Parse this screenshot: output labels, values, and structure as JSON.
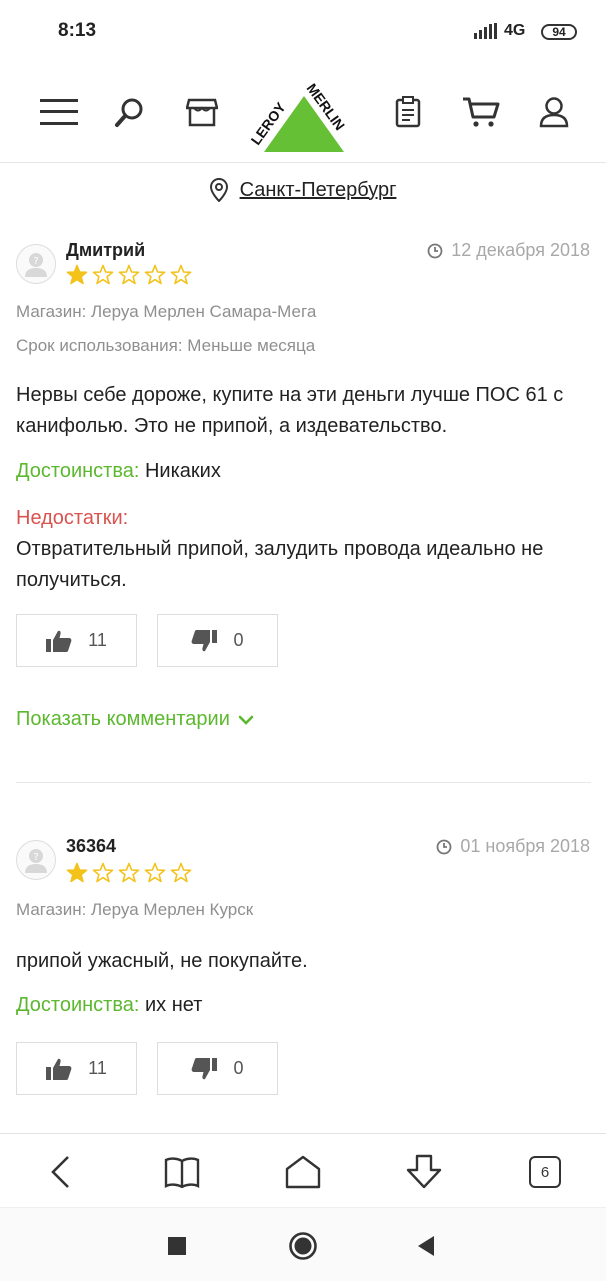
{
  "status": {
    "time": "8:13",
    "network": "4G",
    "battery": "94"
  },
  "city": {
    "name": "Санкт-Петербург"
  },
  "reviews": [
    {
      "author": "Дмитрий",
      "date": "12 декабря 2018",
      "rating": 1,
      "store": "Магазин: Леруа Мерлен Самара-Мега",
      "usage": "Срок использования: Меньше месяца",
      "text": "Нервы себе дороже, купите на эти деньги лучше ПОС 61 с канифолью. Это не припой, а издевательство.",
      "pros_label": "Достоинства:",
      "pros": "Никаких",
      "cons_label": "Недостатки:",
      "cons": "Отвратительный припой, залудить провода идеально не получиться.",
      "likes": "11",
      "dislikes": "0",
      "show_comments": "Показать комментарии"
    },
    {
      "author": "36364",
      "date": "01 ноября 2018",
      "rating": 1,
      "store": "Магазин: Леруа Мерлен Курск",
      "text": "припой ужасный, не покупайте.",
      "pros_label": "Достоинства:",
      "pros": "их нет",
      "likes": "11",
      "dislikes": "0"
    }
  ],
  "browser": {
    "tabs_count": "6"
  },
  "logo": {
    "text_left": "LEROY",
    "text_right": "MERLIN"
  },
  "colors": {
    "accent_green": "#5cb82e",
    "cons_red": "#d9534f",
    "star_gold": "#f3c21b"
  }
}
